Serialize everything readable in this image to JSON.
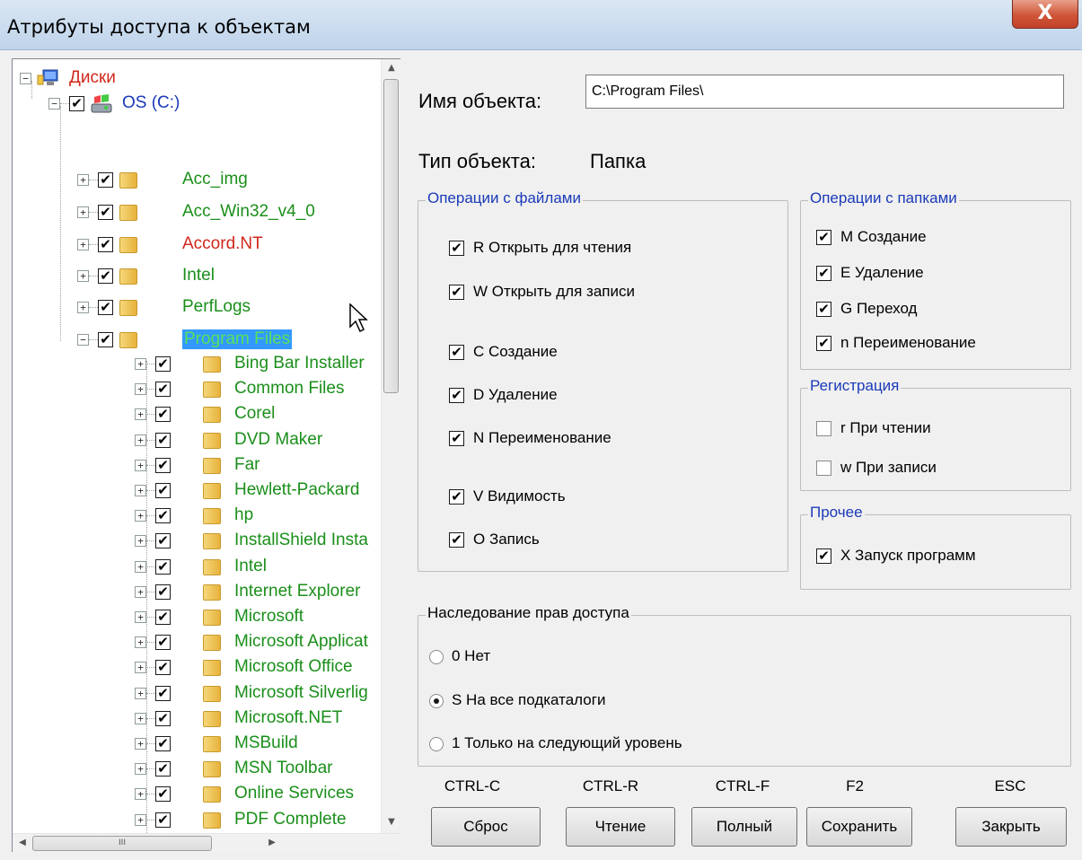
{
  "window": {
    "title": "Атрибуты доступа к объектам",
    "close_glyph": "X"
  },
  "tree": {
    "root_label": "Диски",
    "drive_label": "OS (C:)",
    "folders": [
      {
        "label": "Acc_img",
        "color": "#1a8f1a"
      },
      {
        "label": "Acc_Win32_v4_0",
        "color": "#1a8f1a"
      },
      {
        "label": "Accord.NT",
        "color": "#d0281c"
      },
      {
        "label": "Intel",
        "color": "#1a8f1a"
      },
      {
        "label": "PerfLogs",
        "color": "#1a8f1a"
      },
      {
        "label": "Program Files",
        "color": "#59e05a",
        "selected": true
      }
    ],
    "subfolders": [
      "Bing Bar Installer",
      "Common Files",
      "Corel",
      "DVD Maker",
      "Far",
      "Hewlett-Packard",
      "hp",
      "InstallShield Insta",
      "Intel",
      "Internet Explorer",
      "Microsoft",
      "Microsoft Applicat",
      "Microsoft Office",
      "Microsoft Silverlig",
      "Microsoft.NET",
      "MSBuild",
      "MSN Toolbar",
      "Online Services",
      "PDF Complete"
    ],
    "hscroll_grip": "III"
  },
  "object": {
    "name_label": "Имя объекта:",
    "name_value": "C:\\Program Files\\",
    "type_label": "Тип объекта:",
    "type_value": "Папка"
  },
  "file_ops": {
    "title": "Операции с файлами",
    "items": [
      {
        "label": "R Открыть для чтения",
        "checked": true
      },
      {
        "label": "W Открыть для записи",
        "checked": true
      },
      {
        "label": "C Создание",
        "checked": true
      },
      {
        "label": "D Удаление",
        "checked": true
      },
      {
        "label": "N Переименование",
        "checked": true
      },
      {
        "label": "V Видимость",
        "checked": true
      },
      {
        "label": "O Запись",
        "checked": true
      }
    ]
  },
  "folder_ops": {
    "title": "Операции с папками",
    "items": [
      {
        "label": "M Создание",
        "checked": true
      },
      {
        "label": "E Удаление",
        "checked": true
      },
      {
        "label": "G Переход",
        "checked": true
      },
      {
        "label": "n Переименование",
        "checked": true
      }
    ]
  },
  "registration": {
    "title": "Регистрация",
    "items": [
      {
        "label": "r При чтении",
        "checked": false
      },
      {
        "label": "w При записи",
        "checked": false
      }
    ]
  },
  "other": {
    "title": "Прочее",
    "items": [
      {
        "label": "X Запуск программ",
        "checked": true
      }
    ]
  },
  "inheritance": {
    "title": "Наследование прав доступа",
    "options": [
      {
        "label": "0 Нет",
        "selected": false
      },
      {
        "label": "S На все подкаталоги",
        "selected": true
      },
      {
        "label": "1 Только на следующий уровень",
        "selected": false
      }
    ]
  },
  "buttons": [
    {
      "key": "CTRL-C",
      "label": "Сброс"
    },
    {
      "key": "CTRL-R",
      "label": "Чтение"
    },
    {
      "key": "CTRL-F",
      "label": "Полный"
    },
    {
      "key": "F2",
      "label": "Сохранить"
    },
    {
      "key": "ESC",
      "label": "Закрыть"
    }
  ],
  "check_glyph": "✔"
}
